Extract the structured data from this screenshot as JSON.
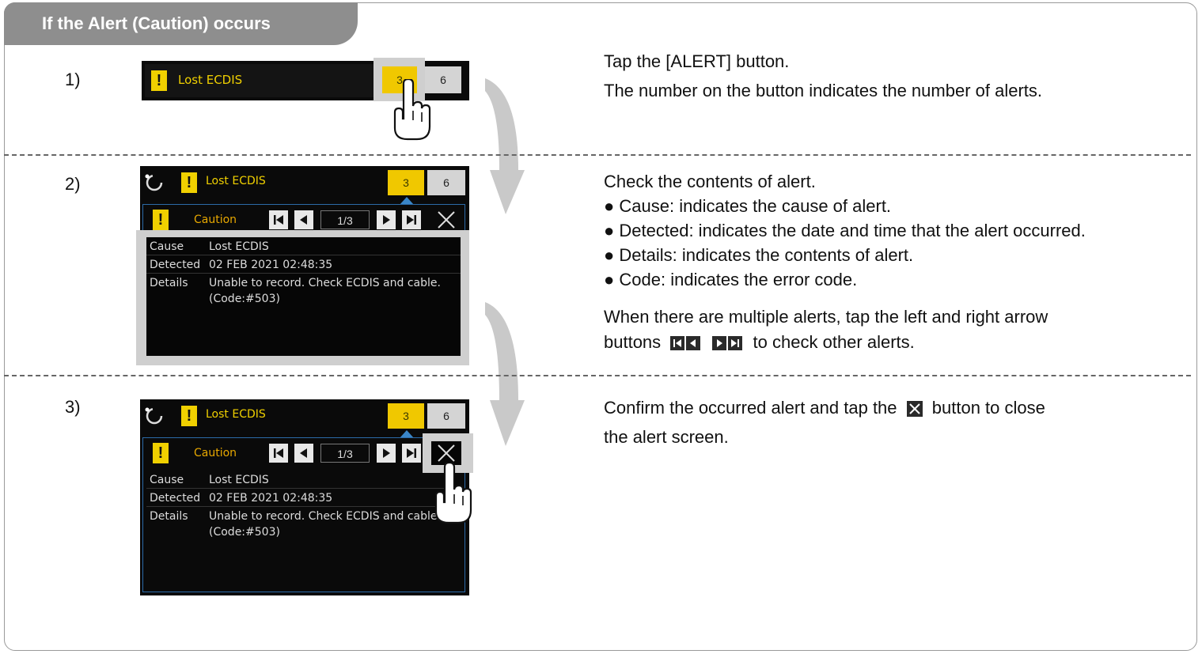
{
  "header": {
    "title": "If the Alert (Caution) occurs"
  },
  "steps": [
    {
      "num": "1)",
      "lines": [
        "Tap the [ALERT] button.",
        "The number on the button indicates the number of alerts."
      ]
    },
    {
      "num": "2)",
      "intro": "Check the contents of alert.",
      "bullets": [
        "● Cause: indicates the cause of alert.",
        "● Detected: indicates the date and time that the alert occurred.",
        "● Details: indicates the contents of alert.",
        "● Code: indicates the error code."
      ],
      "multi_1": "When there are multiple alerts, tap the left and right arrow",
      "multi_2a": "buttons",
      "multi_2b": "to check other alerts."
    },
    {
      "num": "3)",
      "line_1a": "Confirm the occurred alert and tap the",
      "line_1b": "button to close",
      "line_2": "the alert screen."
    }
  ],
  "alert_ui": {
    "bar_text": "Lost ECDIS",
    "alert_count": "3",
    "other_count": "6",
    "severity": "Caution",
    "page": "1/3",
    "rows": [
      {
        "label": "Cause",
        "value": "Lost ECDIS"
      },
      {
        "label": "Detected",
        "value": "02 FEB 2021 02:48:35"
      },
      {
        "label": "Details",
        "value": "Unable to record. Check ECDIS and cable."
      }
    ],
    "code_line": "(Code:#503)"
  },
  "icons": [
    "warning-icon",
    "hand-pointer-icon",
    "first-icon",
    "prev-icon",
    "next-icon",
    "last-icon",
    "close-icon",
    "curved-arrow-icon",
    "spinner-icon"
  ],
  "colors": {
    "accent_yellow": "#f0c800",
    "header_gray": "#8e8e8e",
    "caution_text": "#e8a800"
  }
}
